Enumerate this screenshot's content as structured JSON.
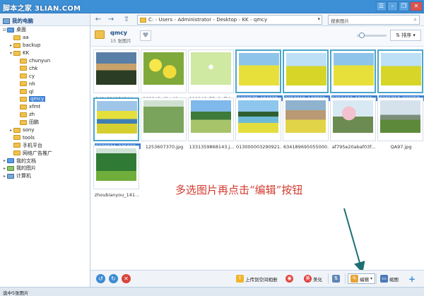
{
  "window": {
    "watermark": "脚本之家 3LIAN.COM",
    "controls": [
      "☰",
      "–",
      "❐",
      "✕"
    ]
  },
  "tree": {
    "root_label": "我的电脑",
    "items": [
      {
        "label": "桌面",
        "level": 0,
        "toggle": "⊟",
        "icon": "blue"
      },
      {
        "label": "aa",
        "level": 1,
        "toggle": "",
        "icon": "folder"
      },
      {
        "label": "backup",
        "level": 1,
        "toggle": "▸",
        "icon": "folder"
      },
      {
        "label": "KK",
        "level": 1,
        "toggle": "▾",
        "icon": "folder"
      },
      {
        "label": "chunyun",
        "level": 2,
        "toggle": "",
        "icon": "folder"
      },
      {
        "label": "chk",
        "level": 2,
        "toggle": "",
        "icon": "folder"
      },
      {
        "label": "cy",
        "level": 2,
        "toggle": "",
        "icon": "folder"
      },
      {
        "label": "nh",
        "level": 2,
        "toggle": "",
        "icon": "folder"
      },
      {
        "label": "ql",
        "level": 2,
        "toggle": "",
        "icon": "folder"
      },
      {
        "label": "qmcy",
        "level": 2,
        "toggle": "",
        "icon": "folder",
        "selected": true
      },
      {
        "label": "xfmt",
        "level": 2,
        "toggle": "",
        "icon": "folder"
      },
      {
        "label": "zh",
        "level": 2,
        "toggle": "",
        "icon": "folder"
      },
      {
        "label": "田鹏",
        "level": 2,
        "toggle": "",
        "icon": "folder"
      },
      {
        "label": "sony",
        "level": 1,
        "toggle": "▸",
        "icon": "folder"
      },
      {
        "label": "tools",
        "level": 1,
        "toggle": "",
        "icon": "folder"
      },
      {
        "label": "手机平台",
        "level": 1,
        "toggle": "",
        "icon": "folder"
      },
      {
        "label": "网络广告推广",
        "level": 1,
        "toggle": "",
        "icon": "folder"
      },
      {
        "label": "我的文档",
        "level": 0,
        "toggle": "▸",
        "icon": "blue"
      },
      {
        "label": "我的图片",
        "level": 0,
        "toggle": "▸",
        "icon": "pic"
      },
      {
        "label": "计算机",
        "level": 0,
        "toggle": "▸",
        "icon": "pc"
      }
    ]
  },
  "nav": {
    "back": "←",
    "forward": "→",
    "up": "⇧",
    "path": [
      "C:",
      "Users",
      "Administrator",
      "Desktop",
      "KK",
      "qmcy"
    ],
    "search_placeholder": "搜索图片"
  },
  "folder": {
    "name": "qmcy",
    "count": "15 张图片",
    "sort_label": "⇅ 排序 ▾",
    "zoom_level": 0.1
  },
  "thumbnails": [
    {
      "caption": "349_09413424.jpg",
      "style": "p-sunset",
      "selected": false
    },
    {
      "caption": "182843q6bq49rr...",
      "style": "p-flower",
      "selected": false
    },
    {
      "caption": "210148z75u8uffd...",
      "style": "p-girl",
      "selected": false
    },
    {
      "caption": "2398978_184228...",
      "style": "p-field",
      "selected": true
    },
    {
      "caption": "3252219_142922...",
      "style": "p-field2",
      "selected": true
    },
    {
      "caption": "5252423_184421...",
      "style": "p-field",
      "selected": true
    },
    {
      "caption": "8205317_222359...",
      "style": "p-field2",
      "selected": true
    },
    {
      "caption": "9370834_235023...",
      "style": "p-river",
      "selected": true
    },
    {
      "caption": "1253607370.jpg",
      "style": "p-willow",
      "selected": false
    },
    {
      "caption": "1331359868143.j...",
      "style": "p-valley",
      "selected": false
    },
    {
      "caption": "013000003290921...",
      "style": "p-lake",
      "selected": false
    },
    {
      "caption": "634189695055000...",
      "style": "p-village",
      "selected": false
    },
    {
      "caption": "af795e20abaf03f...",
      "style": "p-cherry",
      "selected": false
    },
    {
      "caption": "QA97.jpg",
      "style": "p-mount",
      "selected": false
    },
    {
      "caption": "zhoubianyou_141...",
      "style": "p-forest",
      "selected": false
    }
  ],
  "annotation": "多选图片再点击“编辑”按钮",
  "bottom": {
    "upload_label": "上传到空间相册",
    "beautify_label": "美化",
    "edit_label": "编辑",
    "thumb_label": "缩图",
    "add": "+"
  },
  "tooltip": "编辑",
  "status": "选中5张图片",
  "colors": {
    "annotation": "#d23a2e",
    "selection": "#3b7fd3",
    "arrow": "#1d6f73"
  }
}
